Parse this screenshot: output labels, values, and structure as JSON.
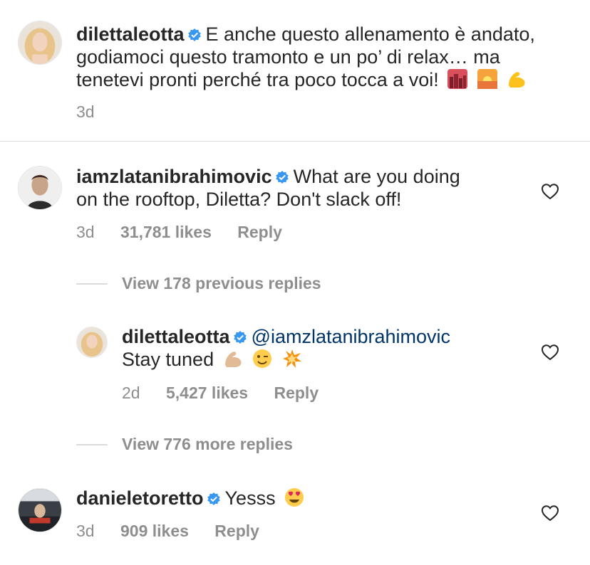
{
  "caption": {
    "username": "dilettaleotta",
    "line1": "E anche questo allenamento è andato,",
    "line2": "godiamoci questo tramonto e un po’ di relax… ma",
    "line3": "tenetevi pronti perché tra poco tocca a voi!",
    "emojis": [
      "city-sunset-emoji",
      "sunrise-emoji",
      "flexed-biceps-emoji"
    ],
    "time": "3d"
  },
  "comments": [
    {
      "username": "iamzlatanibrahimovic",
      "line1": "What are you doing",
      "line2": "on the rooftop, Diletta? Don't slack off!",
      "time": "3d",
      "likes": "31,781 likes",
      "reply": "Reply"
    }
  ],
  "replies_previous": "View 178 previous replies",
  "reply": {
    "username": "dilettaleotta",
    "mention": "@iamzlatanibrahimovic",
    "text": "Stay tuned",
    "emojis": [
      "flexed-biceps-emoji",
      "winking-face-emoji",
      "collision-emoji"
    ],
    "time": "2d",
    "likes": "5,427 likes",
    "reply": "Reply"
  },
  "replies_more": "View 776 more replies",
  "comment2": {
    "username": "danieletoretto",
    "text": "Yesss",
    "emoji": "heart-eyes-emoji",
    "time": "3d",
    "likes": "909 likes",
    "reply": "Reply"
  },
  "colors": {
    "verified": "#3897f0",
    "meta": "#8e8e8e",
    "mention": "#003569",
    "text": "#262626"
  }
}
